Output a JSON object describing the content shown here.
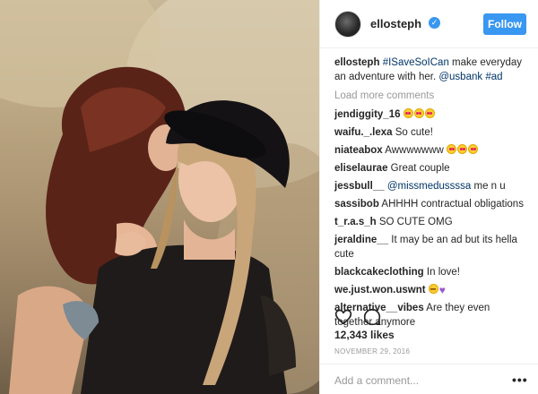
{
  "photo": {
    "alt_icon": "photo"
  },
  "header": {
    "username": "ellosteph",
    "verified_icon": "verified-badge-icon",
    "follow_label": "Follow"
  },
  "caption": {
    "username": "ellosteph",
    "hashtag1": "#ISaveSoICan",
    "text1": " make everyday an adventure with her. ",
    "mention": "@usbank",
    "hashtag2": "#ad"
  },
  "load_more": "Load more comments",
  "comments": [
    {
      "user": "jendiggity_16",
      "text": "",
      "emoji_count": 3
    },
    {
      "user": "waifu._.lexa",
      "text": "So cute!"
    },
    {
      "user": "niateabox",
      "text": "Awwwwwww",
      "emoji_count": 3
    },
    {
      "user": "eliselaurae",
      "text": "Great couple"
    },
    {
      "user": "jessbull__",
      "mention": "@missmedussssa",
      "text": " me n u"
    },
    {
      "user": "sassibob",
      "text": "AHHHH contractual obligations"
    },
    {
      "user": "t_r.a.s_h",
      "text": "SO CUTE OMG"
    },
    {
      "user": "jeraldine__",
      "text": "It may be an ad but its hella cute"
    },
    {
      "user": "blackcakeclothing",
      "text": "In love!"
    },
    {
      "user": "we.just.won.uswnt",
      "text": ""
    },
    {
      "user": "alternative__vibes",
      "text": "Are they even together anymore"
    }
  ],
  "actions": {
    "like_icon": "heart-icon",
    "comment_icon": "comment-icon"
  },
  "likes": "12,343 likes",
  "date": "NOVEMBER 29, 2016",
  "add_comment": {
    "placeholder": "Add a comment...",
    "more_icon": "more-options-icon",
    "more_label": "•••"
  }
}
